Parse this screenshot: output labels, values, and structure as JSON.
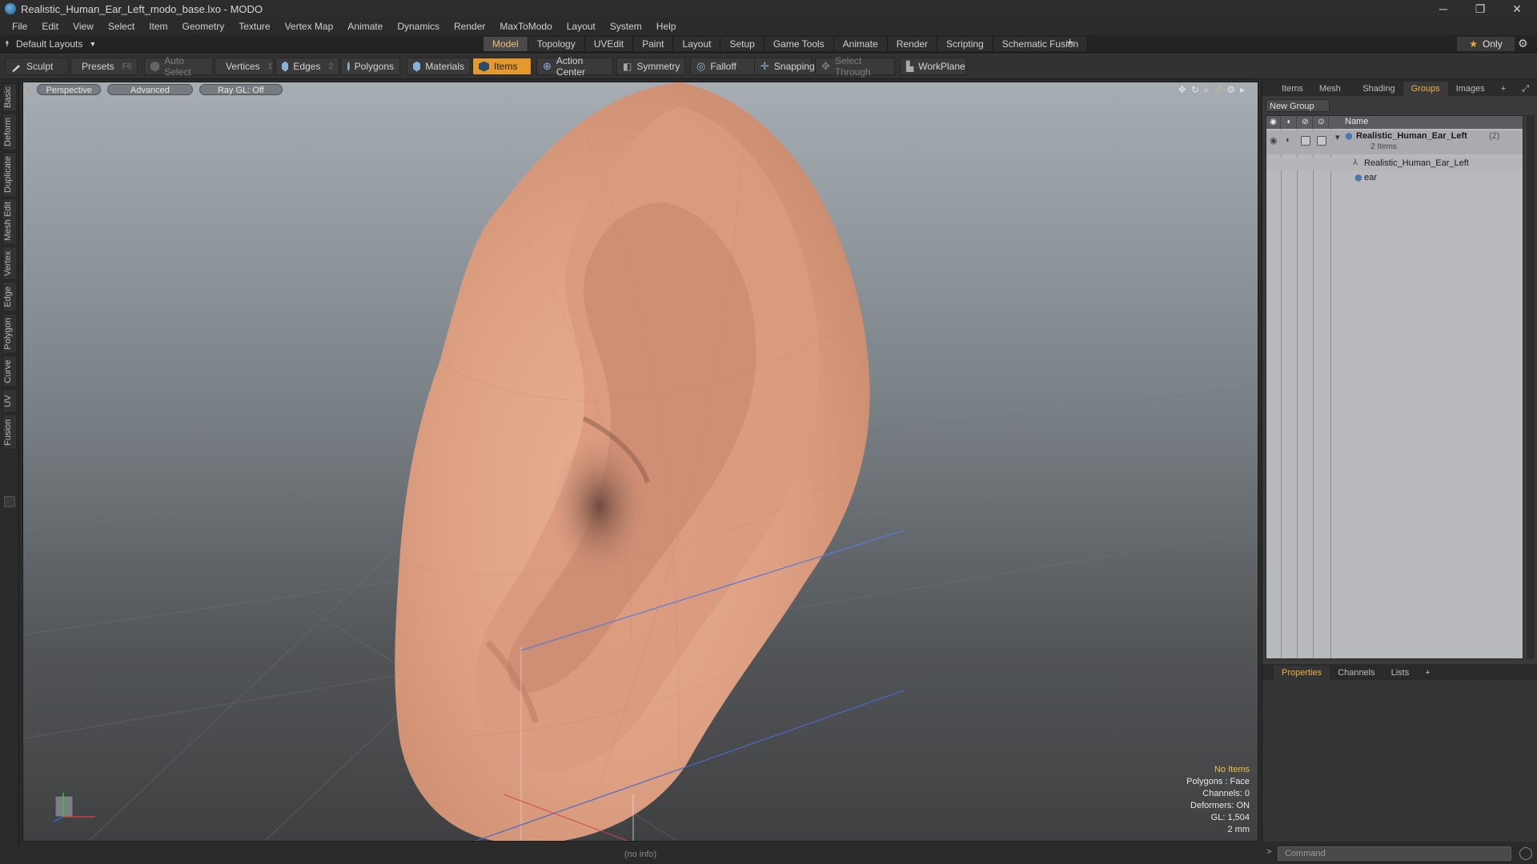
{
  "window": {
    "title": "Realistic_Human_Ear_Left_modo_base.lxo - MODO",
    "minimize": "─",
    "restore": "❐",
    "close": "✕"
  },
  "menu": [
    "File",
    "Edit",
    "View",
    "Select",
    "Item",
    "Geometry",
    "Texture",
    "Vertex Map",
    "Animate",
    "Dynamics",
    "Render",
    "MaxToModo",
    "Layout",
    "System",
    "Help"
  ],
  "layouts": {
    "label": "Default Layouts",
    "tabs": [
      "Model",
      "Topology",
      "UVEdit",
      "Paint",
      "Layout",
      "Setup",
      "Game Tools",
      "Animate",
      "Render",
      "Scripting",
      "Schematic Fusion"
    ],
    "active_tab": "Model",
    "plus": "+",
    "only_label": "Only"
  },
  "toolbar": {
    "sculpt": "Sculpt",
    "presets": "Presets",
    "presets_key": "F6",
    "auto_select": "Auto Select",
    "vertices": "Vertices",
    "vertices_key": "1",
    "edges": "Edges",
    "edges_key": "2",
    "polygons": "Polygons",
    "materials": "Materials",
    "items": "Items",
    "action_center": "Action Center",
    "symmetry": "Symmetry",
    "falloff": "Falloff",
    "snapping": "Snapping",
    "select_through": "Select Through",
    "workplane": "WorkPlane"
  },
  "left_tabs": [
    "Basic",
    "Deform",
    "Duplicate",
    "Mesh Edit",
    "Vertex",
    "Edge",
    "Polygon",
    "Curve",
    "UV",
    "Fusion"
  ],
  "viewport": {
    "view_mode": "Perspective",
    "shading": "Advanced",
    "raygl": "Ray GL: Off",
    "info": {
      "no_items": "No Items",
      "polygons": "Polygons : Face",
      "channels": "Channels: 0",
      "deformers": "Deformers: ON",
      "gl": "GL: 1,504",
      "scale": "2 mm"
    },
    "status": "(no info)"
  },
  "right_panel": {
    "tabs": [
      "Items",
      "Mesh ...",
      "Shading",
      "Groups",
      "Images"
    ],
    "active_tab": "Groups",
    "new_group": "New Group",
    "column_name": "Name",
    "group_name": "Realistic_Human_Ear_Left",
    "group_count": "(2)",
    "group_items": "2 Items",
    "children": [
      "Realistic_Human_Ear_Left",
      "ear"
    ]
  },
  "properties": {
    "tabs": [
      "Properties",
      "Channels",
      "Lists"
    ],
    "active_tab": "Properties"
  },
  "command": {
    "placeholder": "Command"
  },
  "colors": {
    "accent": "#e39a2a",
    "active_tab_text": "#f0b040",
    "skin": "#e0a184"
  }
}
